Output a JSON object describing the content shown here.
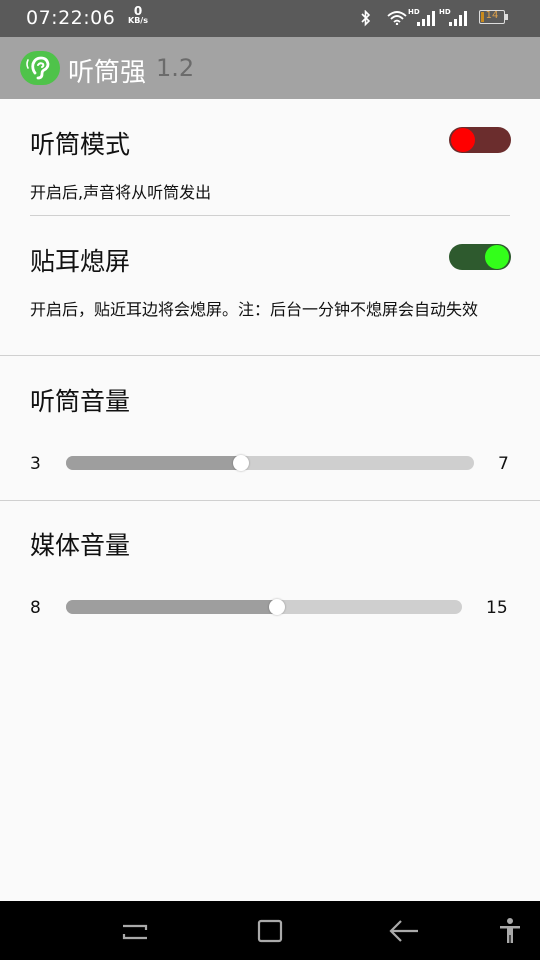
{
  "status_bar": {
    "time": "07:22:06",
    "net_speed_value": "0",
    "net_speed_unit": "KB/s",
    "battery_level": "14",
    "battery_fraction": 0.14,
    "hd1": "HD",
    "hd2": "HD",
    "icons": [
      "bluetooth-icon",
      "wifi-icon",
      "signal-icon",
      "signal-icon",
      "battery-icon"
    ]
  },
  "app_bar": {
    "title": "听筒强",
    "version": "1.2",
    "logo_icon": "ear-icon",
    "logo_color": "#4fc34a"
  },
  "settings": {
    "receiver_mode": {
      "title": "听筒模式",
      "summary": "开启后,声音将从听筒发出",
      "enabled": true,
      "thumb_color": "#ff0000",
      "track_color": "#6b2d2d"
    },
    "ear_screen_off": {
      "title": "贴耳熄屏",
      "summary": "开启后，贴近耳边将会熄屏。注：后台一分钟不熄屏会自动失效",
      "enabled": true,
      "thumb_color": "#33ff1a",
      "track_color": "#2e5a2e"
    },
    "receiver_volume": {
      "title": "听筒音量",
      "value": "3",
      "max": "7"
    },
    "media_volume": {
      "title": "媒体音量",
      "value": "8",
      "max": "15"
    }
  },
  "nav_bar": {
    "buttons": [
      "recents-icon",
      "home-icon",
      "back-icon",
      "accessibility-icon"
    ]
  }
}
